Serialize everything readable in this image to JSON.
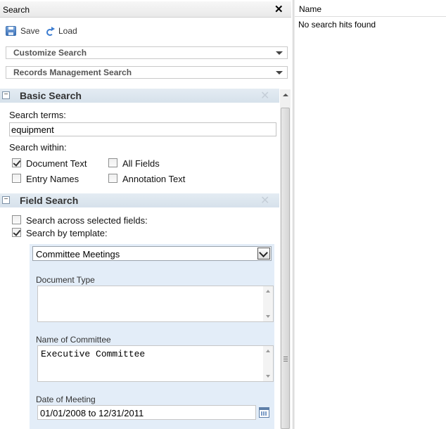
{
  "search_panel": {
    "title": "Search",
    "close_glyph": "✕",
    "toolbar": {
      "save_label": "Save",
      "load_label": "Load"
    },
    "customize_dropdown": "Customize Search",
    "records_dropdown": "Records Management Search"
  },
  "basic_search": {
    "header": "Basic Search",
    "search_terms_label": "Search terms:",
    "search_terms_value": "equipment",
    "search_within_label": "Search within:",
    "options": [
      {
        "label": "Document Text",
        "checked": true
      },
      {
        "label": "All Fields",
        "checked": false
      },
      {
        "label": "Entry Names",
        "checked": false
      },
      {
        "label": "Annotation Text",
        "checked": false
      }
    ]
  },
  "field_search": {
    "header": "Field Search",
    "across_fields_label": "Search across selected fields:",
    "across_fields_checked": false,
    "by_template_label": "Search by template:",
    "by_template_checked": true,
    "template_selected": "Committee Meetings",
    "fields": {
      "document_type_label": "Document Type",
      "document_type_value": "",
      "committee_label": "Name of Committee",
      "committee_value": "Executive Committee",
      "date_label": "Date of Meeting",
      "date_value": "01/01/2008 to 12/31/2011"
    }
  },
  "results_panel": {
    "column_name": "Name",
    "empty_message": "No search hits found"
  },
  "icons": {
    "save": "save-icon",
    "load": "load-icon",
    "calendar": "calendar-icon",
    "collapse": "collapse-icon"
  }
}
